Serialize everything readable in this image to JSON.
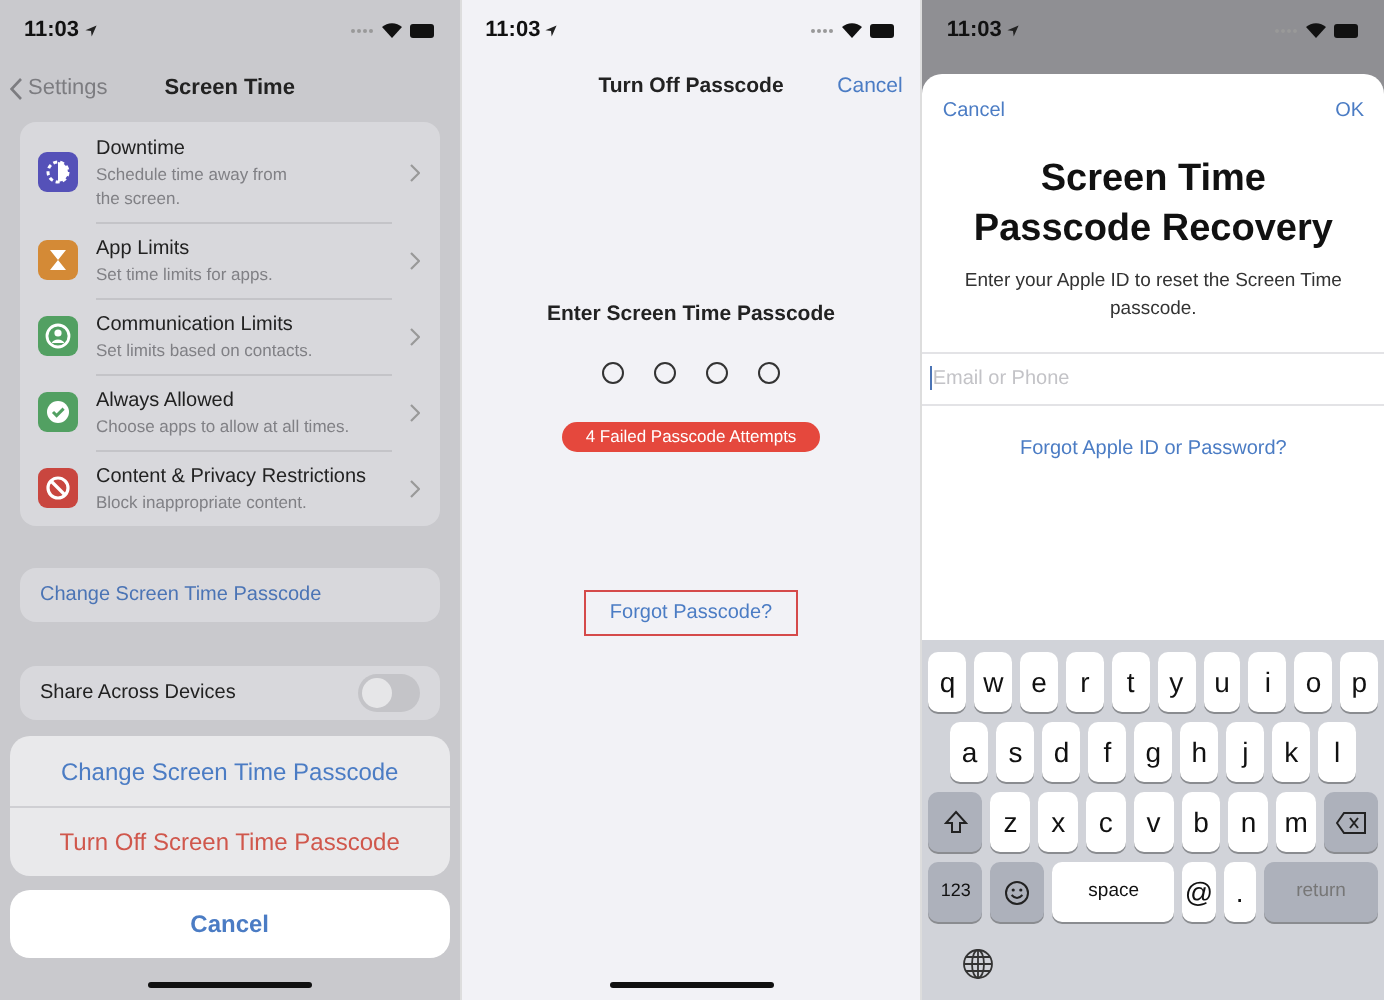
{
  "settings_screen": {
    "status_bar": {
      "time": "11:03"
    },
    "nav": {
      "back": "Settings",
      "title": "Screen Time"
    },
    "items": [
      {
        "title": "Downtime",
        "subtitle": "Schedule time away from the screen.",
        "color": "#5551b8",
        "kind": "downtime"
      },
      {
        "title": "App Limits",
        "subtitle": "Set time limits for apps.",
        "color": "#d48a36",
        "kind": "hourglass"
      },
      {
        "title": "Communication Limits",
        "subtitle": "Set limits based on contacts.",
        "color": "#52a062",
        "kind": "person"
      },
      {
        "title": "Always Allowed",
        "subtitle": "Choose apps to allow at all times.",
        "color": "#52a062",
        "kind": "check"
      },
      {
        "title": "Content & Privacy Restrictions",
        "subtitle": "Block inappropriate content.",
        "color": "#c9463f",
        "kind": "block"
      }
    ],
    "change_passcode_link": "Change Screen Time Passcode",
    "share_across_devices": {
      "label": "Share Across Devices",
      "on": false
    },
    "action_sheet": {
      "actions": [
        {
          "label": "Change Screen Time Passcode",
          "kind": "default"
        },
        {
          "label": "Turn Off Screen Time Passcode",
          "kind": "destructive"
        }
      ],
      "cancel": "Cancel"
    }
  },
  "passcode_screen": {
    "status_bar": {
      "time": "11:03"
    },
    "title": "Turn Off Passcode",
    "cancel": "Cancel",
    "prompt": "Enter Screen Time Passcode",
    "dots": [
      {
        "filled": false
      },
      {
        "filled": false
      },
      {
        "filled": false
      },
      {
        "filled": false
      }
    ],
    "error_badge": "4 Failed Passcode Attempts",
    "forgot_link": {
      "label": "Forgot Passcode?",
      "highlighted": true
    }
  },
  "recovery_screen": {
    "status_bar": {
      "time": "11:03"
    },
    "cancel": "Cancel",
    "ok": "OK",
    "title": "Screen Time Passcode Recovery",
    "subtitle": "Enter your Apple ID to reset the Screen Time passcode.",
    "field": {
      "placeholder": "Email or Phone"
    },
    "forgot_link": "Forgot Apple ID or Password?",
    "keyboard": [
      [
        {
          "kind": "letter",
          "label": "q"
        },
        {
          "kind": "letter",
          "label": "w"
        },
        {
          "kind": "letter",
          "label": "e"
        },
        {
          "kind": "letter",
          "label": "r"
        },
        {
          "kind": "letter",
          "label": "t"
        },
        {
          "kind": "letter",
          "label": "y"
        },
        {
          "kind": "letter",
          "label": "u"
        },
        {
          "kind": "letter",
          "label": "i"
        },
        {
          "kind": "letter",
          "label": "o"
        },
        {
          "kind": "letter",
          "label": "p"
        }
      ],
      [
        {
          "kind": "letter",
          "label": "a"
        },
        {
          "kind": "letter",
          "label": "s"
        },
        {
          "kind": "letter",
          "label": "d"
        },
        {
          "kind": "letter",
          "label": "f"
        },
        {
          "kind": "letter",
          "label": "g"
        },
        {
          "kind": "letter",
          "label": "h"
        },
        {
          "kind": "letter",
          "label": "j"
        },
        {
          "kind": "letter",
          "label": "k"
        },
        {
          "kind": "letter",
          "label": "l"
        }
      ],
      [
        {
          "kind": "shift"
        },
        {
          "kind": "letter",
          "label": "z"
        },
        {
          "kind": "letter",
          "label": "x"
        },
        {
          "kind": "letter",
          "label": "c"
        },
        {
          "kind": "letter",
          "label": "v"
        },
        {
          "kind": "letter",
          "label": "b"
        },
        {
          "kind": "letter",
          "label": "n"
        },
        {
          "kind": "letter",
          "label": "m"
        },
        {
          "kind": "delete"
        }
      ],
      [
        {
          "kind": "mode",
          "label": "123"
        },
        {
          "kind": "emoji"
        },
        {
          "kind": "space",
          "label": "space"
        },
        {
          "kind": "letter",
          "label": "@"
        },
        {
          "kind": "letter",
          "label": "."
        },
        {
          "kind": "return",
          "label": "return"
        }
      ]
    ]
  }
}
